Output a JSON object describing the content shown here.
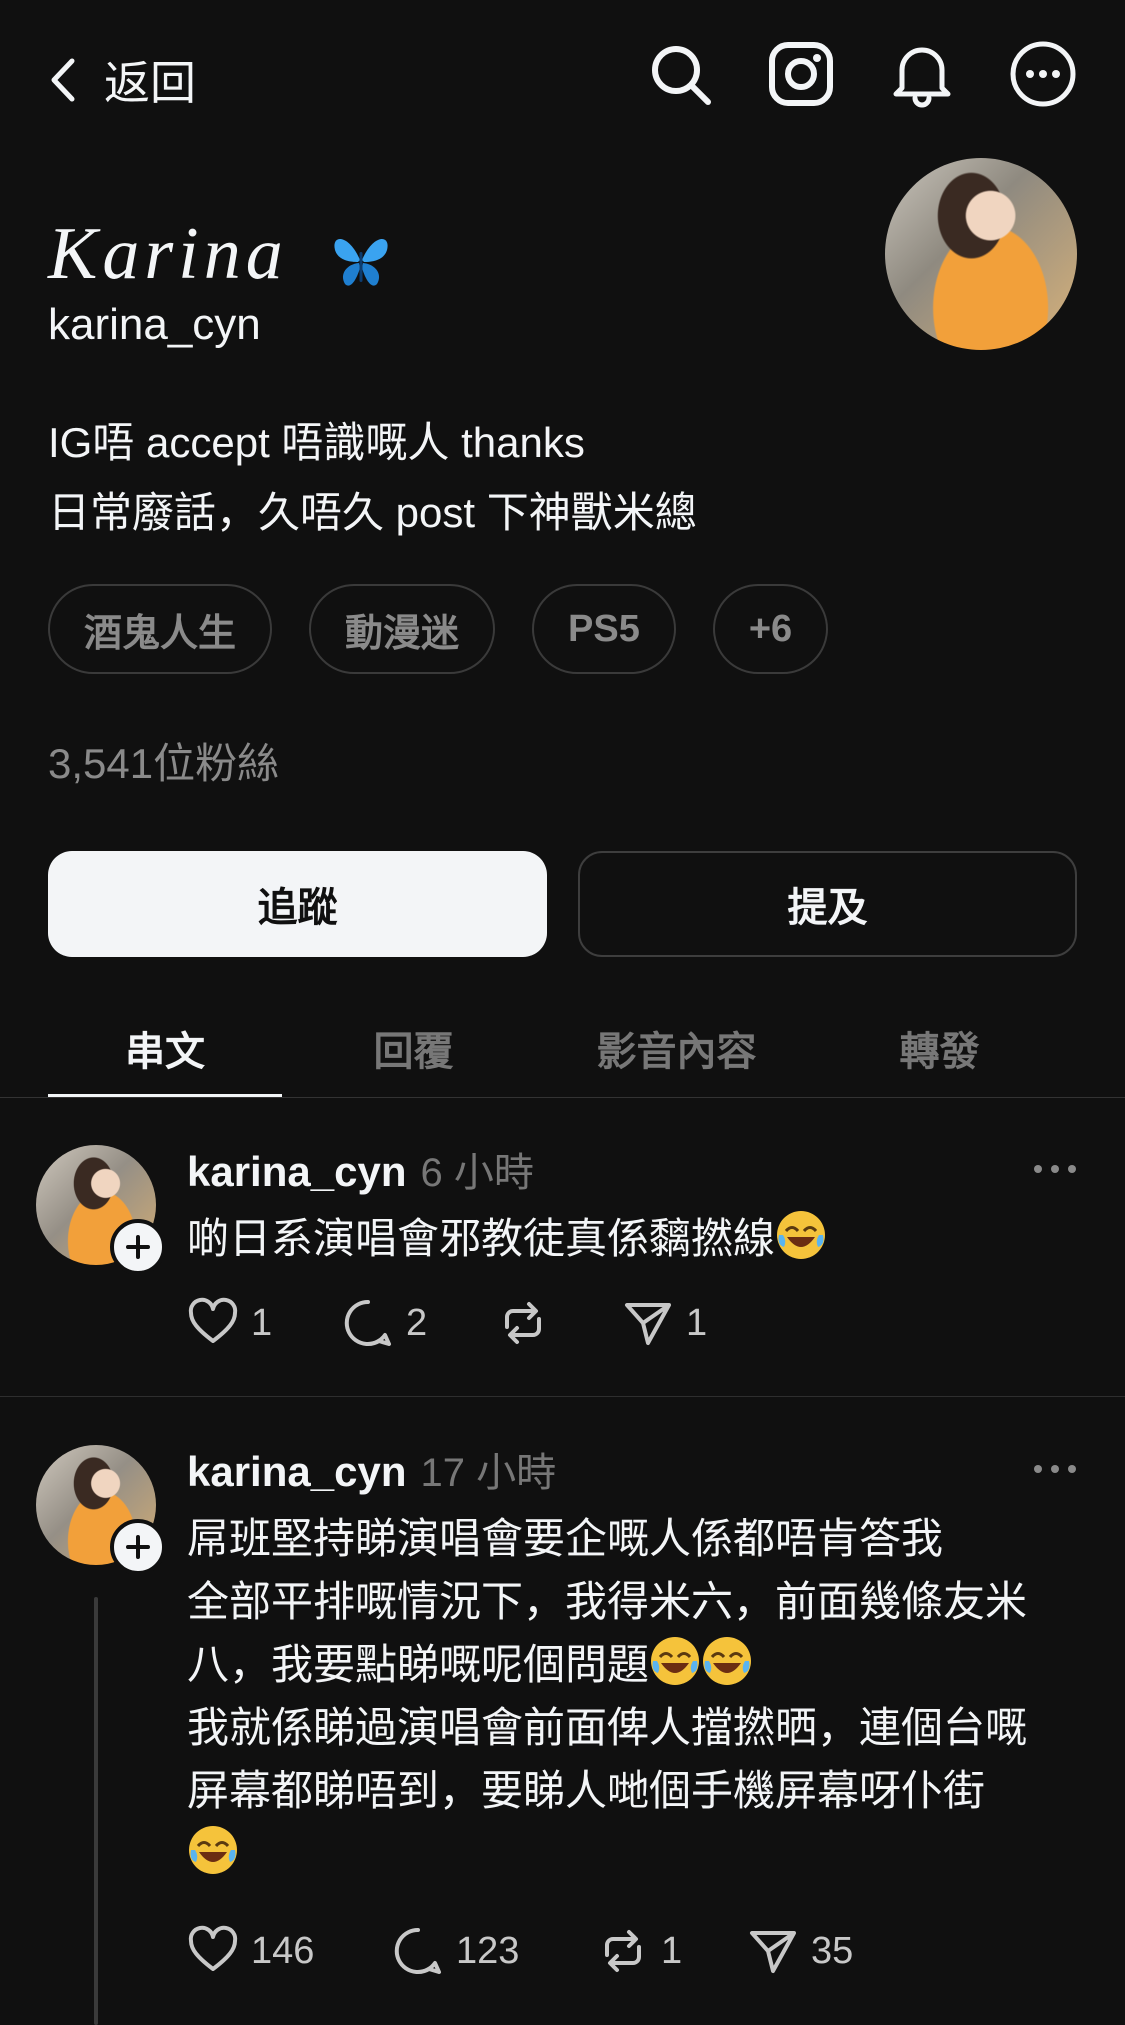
{
  "topbar": {
    "back_label": "返回",
    "icons": [
      "search-icon",
      "instagram-icon",
      "bell-icon",
      "more-icon"
    ]
  },
  "profile": {
    "display_name": "Karina",
    "name_emoji": "butterfly",
    "handle": "karina_cyn",
    "bio_lines": [
      "IG唔 accept 唔識嘅人 thanks",
      "日常廢話，久唔久 post 下神獸米總"
    ],
    "tags": [
      "酒鬼人生",
      "動漫迷",
      "PS5",
      "+6"
    ],
    "followers": "3,541位粉絲"
  },
  "buttons": {
    "follow": "追蹤",
    "mention": "提及"
  },
  "tabs": [
    {
      "label": "串文",
      "active": true
    },
    {
      "label": "回覆",
      "active": false
    },
    {
      "label": "影音內容",
      "active": false
    },
    {
      "label": "轉發",
      "active": false
    }
  ],
  "posts": [
    {
      "user": "karina_cyn",
      "time": "6 小時",
      "lines": [
        "啲日系演唱會邪教徒真係黐撚線"
      ],
      "likes": "1",
      "replies": "2",
      "reposts": "",
      "shares": "1"
    },
    {
      "user": "karina_cyn",
      "time": "17 小時",
      "lines": [
        "屌班堅持睇演唱會要企嘅人係都唔肯答我",
        "全部平排嘅情況下，我得米六，前面幾條友米",
        "八，我要點睇嘅呢個問題",
        "我就係睇過演唱會前面俾人擋撚晒，連個台嘅",
        "屏幕都睇唔到，要睇人哋個手機屏幕呀仆街"
      ],
      "likes": "146",
      "replies": "123",
      "reposts": "1",
      "shares": "35"
    }
  ]
}
